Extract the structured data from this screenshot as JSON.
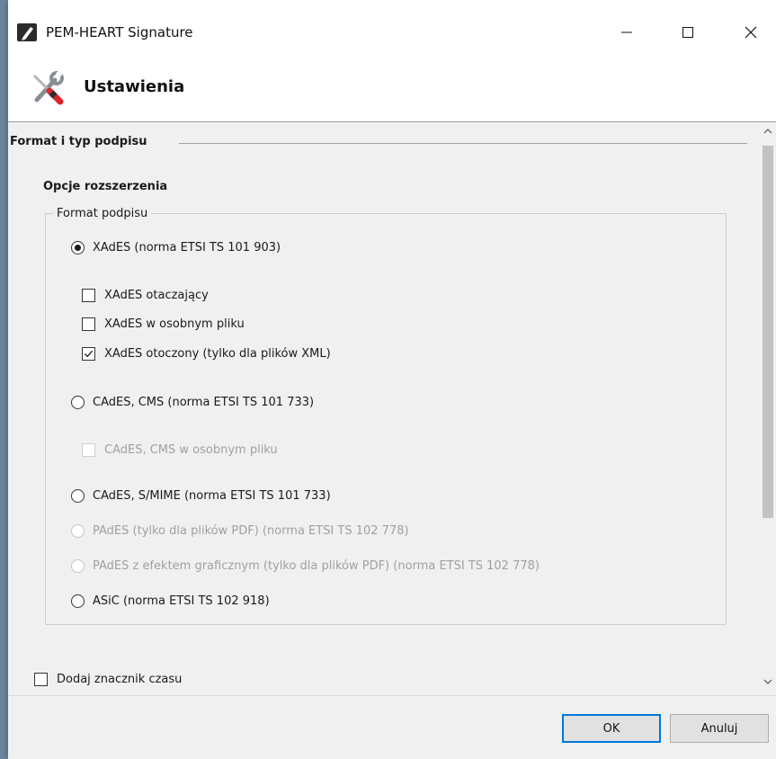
{
  "window": {
    "title": "PEM-HEART Signature",
    "header_title": "Ustawienia",
    "icons": {
      "app": "pen-icon",
      "header": "tools-icon"
    }
  },
  "section": {
    "title": "Format i typ podpisu",
    "subtitle": "Opcje rozszerzenia",
    "group_label": "Format podpisu"
  },
  "options": {
    "xades": {
      "label": "XAdES (norma ETSI TS 101 903)",
      "selected": true
    },
    "xades_enveloping": {
      "label": "XAdES otaczający",
      "checked": false
    },
    "xades_detached": {
      "label": "XAdES w osobnym pliku",
      "checked": false
    },
    "xades_enveloped": {
      "label": "XAdES otoczony (tylko dla plików XML)",
      "checked": true
    },
    "cades_cms": {
      "label": "CAdES, CMS  (norma ETSI TS 101 733)",
      "selected": false
    },
    "cades_cms_detached": {
      "label": "CAdES, CMS w osobnym pliku",
      "checked": false,
      "disabled": true
    },
    "cades_smime": {
      "label": "CAdES, S/MIME (norma ETSI TS 101 733)",
      "selected": false
    },
    "pades": {
      "label": "PAdES  (tylko dla plików PDF) (norma ETSI TS 102 778)",
      "selected": false,
      "disabled": true
    },
    "pades_graphic": {
      "label": "PAdES  z efektem graficznym (tylko dla plików PDF) (norma ETSI TS 102 778)",
      "selected": false,
      "disabled": true
    },
    "asic": {
      "label": "ASiC (norma ETSI TS 102 918)",
      "selected": false
    }
  },
  "timestamp": {
    "label": "Dodaj znacznik czasu",
    "checked": false
  },
  "buttons": {
    "ok": "OK",
    "cancel": "Anuluj"
  },
  "colors": {
    "accent": "#0078d7",
    "disabled_text": "#a0a0a0",
    "background": "#f0f0f0"
  }
}
